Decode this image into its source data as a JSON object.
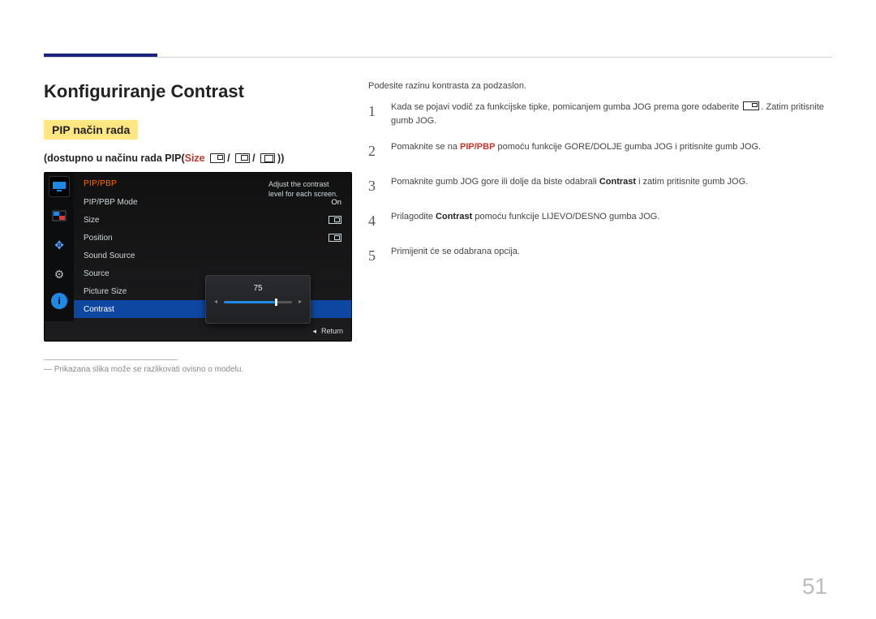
{
  "header": {
    "title": "Konfiguriranje Contrast"
  },
  "pip": {
    "band": "PIP način rada",
    "subhead_prefix": "(dostupno u načinu rada PIP(",
    "size_kw": "Size",
    "subhead_suffix": "))"
  },
  "osd": {
    "title": "PIP/PBP",
    "rows": {
      "mode": {
        "label": "PIP/PBP Mode",
        "value": "On"
      },
      "size": {
        "label": "Size"
      },
      "position": {
        "label": "Position"
      },
      "sound": {
        "label": "Sound Source"
      },
      "source": {
        "label": "Source"
      },
      "psize": {
        "label": "Picture Size"
      },
      "contrast": {
        "label": "Contrast"
      }
    },
    "slider_value": "75",
    "desc": "Adjust the contrast level for each screen.",
    "return": "Return"
  },
  "footnote": "Prikazana slika može se razlikovati ovisno o modelu.",
  "right": {
    "intro": "Podesite razinu kontrasta za podzaslon.",
    "s1a": "Kada se pojavi vodič za funkcijske tipke, pomicanjem gumba JOG prema gore odaberite ",
    "s1b": ". Zatim pritisnite gumb JOG.",
    "s2a": "Pomaknite se na ",
    "s2kw": "PIP/PBP",
    "s2b": " pomoću funkcije GORE/DOLJE gumba JOG i pritisnite gumb JOG.",
    "s3a": "Pomaknite gumb JOG gore ili dolje da biste odabrali ",
    "s3kw": "Contrast",
    "s3b": " i zatim pritisnite gumb JOG.",
    "s4a": "Prilagodite ",
    "s4kw": "Contrast",
    "s4b": " pomoću funkcije LIJEVO/DESNO gumba JOG.",
    "s5": "Primijenit će se odabrana opcija."
  },
  "page_number": "51"
}
